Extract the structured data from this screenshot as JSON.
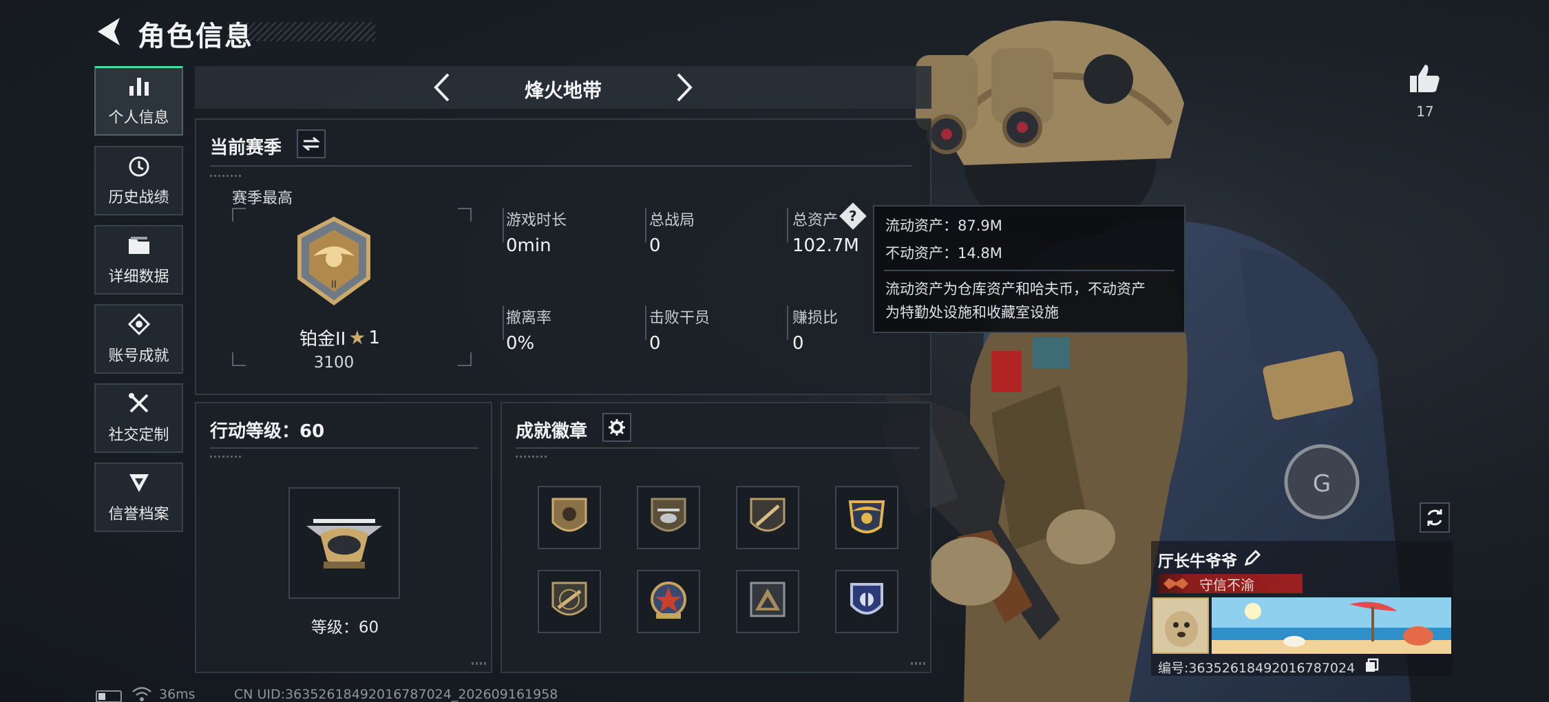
{
  "header": {
    "title": "角色信息"
  },
  "sidebar": {
    "items": [
      {
        "label": "个人信息",
        "icon": "bar-chart-icon",
        "active": true
      },
      {
        "label": "历史战绩",
        "icon": "history-clock-icon",
        "active": false
      },
      {
        "label": "详细数据",
        "icon": "folder-icon",
        "active": false
      },
      {
        "label": "账号成就",
        "icon": "achievement-medal-icon",
        "active": false
      },
      {
        "label": "社交定制",
        "icon": "tools-icon",
        "active": false
      },
      {
        "label": "信誉档案",
        "icon": "shield-rank-icon",
        "active": false
      }
    ]
  },
  "mode_selector": {
    "title": "烽火地带"
  },
  "season": {
    "heading": "当前赛季",
    "best_label": "赛季最高",
    "rank_name": "铂金II",
    "rank_stars": "1",
    "rank_score": "3100",
    "stats": [
      {
        "label": "游戏时长",
        "value": "0min"
      },
      {
        "label": "总战局",
        "value": "0"
      },
      {
        "label": "总资产",
        "value": "102.7M"
      },
      {
        "label": "撤离率",
        "value": "0%"
      },
      {
        "label": "击败干员",
        "value": "0"
      },
      {
        "label": "赚损比",
        "value": "0"
      }
    ]
  },
  "tooltip": {
    "liquid": "流动资产：87.9M",
    "fixed": "不动资产：14.8M",
    "desc_line1": "流动资产为仓库资产和哈夫币，不动资产",
    "desc_line2": "为特勤处设施和收藏室设施"
  },
  "action_level": {
    "heading": "行动等级：60",
    "level_text": "等级：60"
  },
  "achievements": {
    "heading": "成就徽章",
    "badges": [
      "lion-crest-badge-icon",
      "helicopter-badge-icon",
      "rifle-crest-badge-icon",
      "wings-gold-badge-icon",
      "rifle-shield-badge-icon",
      "star-wreath-badge-icon",
      "triangle-badge-icon",
      "blue-shield-badge-icon"
    ]
  },
  "profile": {
    "likes": "17",
    "player_name": "厅长牛爷爷",
    "title_badge": "守信不渝",
    "player_id": "编号:3635261849201678​7024"
  },
  "footer": {
    "ping": "36ms",
    "uid": "CN UID:3635261849201678​7024_202609161958"
  },
  "colors": {
    "accent": "#3fe0a0",
    "rank_gold": "#caa96b",
    "title_red": "#9a2020"
  }
}
